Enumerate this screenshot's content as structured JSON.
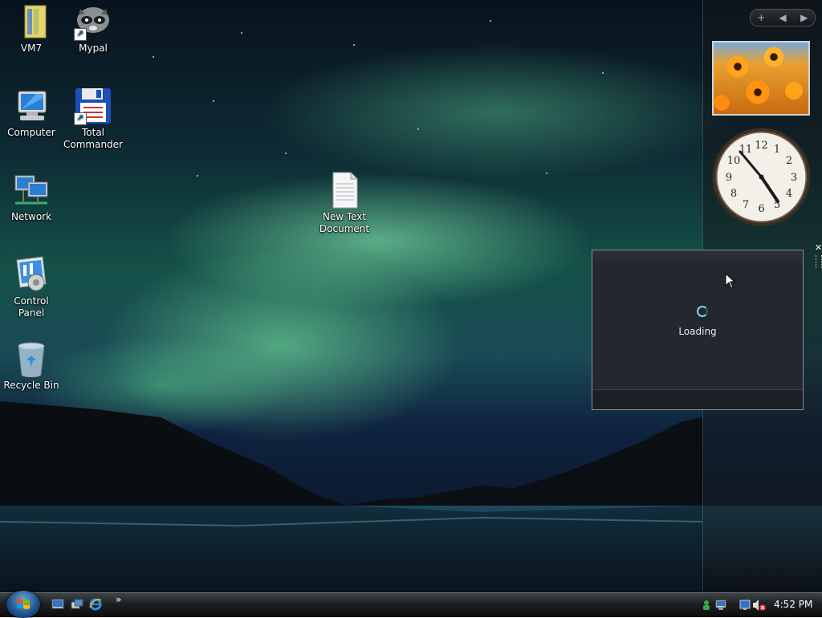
{
  "desktop": {
    "icons": [
      {
        "name": "VM7",
        "type": "folder"
      },
      {
        "name": "Mypal",
        "type": "app-shortcut"
      },
      {
        "name": "Computer",
        "type": "computer"
      },
      {
        "name": "Total\nCommander",
        "type": "app-shortcut"
      },
      {
        "name": "Network",
        "type": "network"
      },
      {
        "name": "New Text\nDocument",
        "type": "text-file"
      },
      {
        "name": "Control Panel",
        "type": "control-panel"
      },
      {
        "name": "Recycle Bin",
        "type": "recycle-bin"
      }
    ]
  },
  "sidebar": {
    "controls": {
      "add": "+",
      "prev": "◀",
      "next": "▶"
    },
    "clock": {
      "hours": "4",
      "minutes": "52"
    },
    "flyout": {
      "status": "Loading",
      "close": "✕"
    }
  },
  "taskbar": {
    "quick_launch": [
      "show-desktop",
      "switch-windows",
      "internet-explorer"
    ],
    "overflow": "»",
    "time": "4:52 PM"
  },
  "colors": {
    "accent": "#7fd5f0",
    "flyout_bg": "#23272f",
    "taskbar": "#1d2022"
  }
}
